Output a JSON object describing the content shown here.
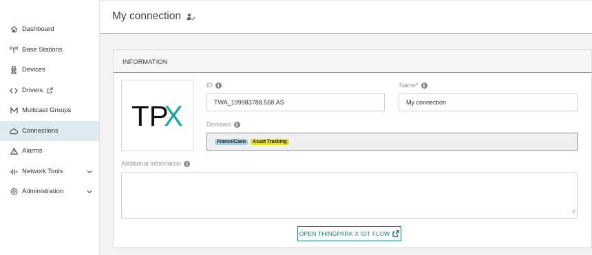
{
  "sidebar": {
    "items": [
      {
        "label": "Dashboard",
        "icon": "home-icon"
      },
      {
        "label": "Base Stations",
        "icon": "antenna-icon"
      },
      {
        "label": "Devices",
        "icon": "device-icon"
      },
      {
        "label": "Drivers",
        "icon": "code-icon",
        "external": true
      },
      {
        "label": "Multicast Groups",
        "icon": "multicast-icon"
      },
      {
        "label": "Connections",
        "icon": "cloud-icon",
        "active": true
      },
      {
        "label": "Alarms",
        "icon": "warning-icon"
      },
      {
        "label": "Network Tools",
        "icon": "signal-icon",
        "expandable": true
      },
      {
        "label": "Administration",
        "icon": "settings-icon",
        "expandable": true
      }
    ]
  },
  "header": {
    "title": "My connection"
  },
  "card": {
    "header": "INFORMATION",
    "logo": {
      "text_dark": "TP",
      "text_accent": "X",
      "accent_color": "#1aa9a0"
    },
    "id": {
      "label": "ID",
      "value": "TWA_199983788.568.AS"
    },
    "name": {
      "label": "Name*",
      "value": "My connection"
    },
    "domains": {
      "label": "Domains",
      "chips": [
        {
          "label": "France/Caen",
          "color": "#a8cde0"
        },
        {
          "label": "Asset Tracking",
          "color": "#e3df2e"
        }
      ]
    },
    "additional": {
      "label": "Additional Information",
      "value": ""
    },
    "flow_button": "OPEN THINGPARK X IOT FLOW"
  },
  "colors": {
    "accent": "#1e7b76",
    "active_nav_bg": "#dcebed"
  }
}
